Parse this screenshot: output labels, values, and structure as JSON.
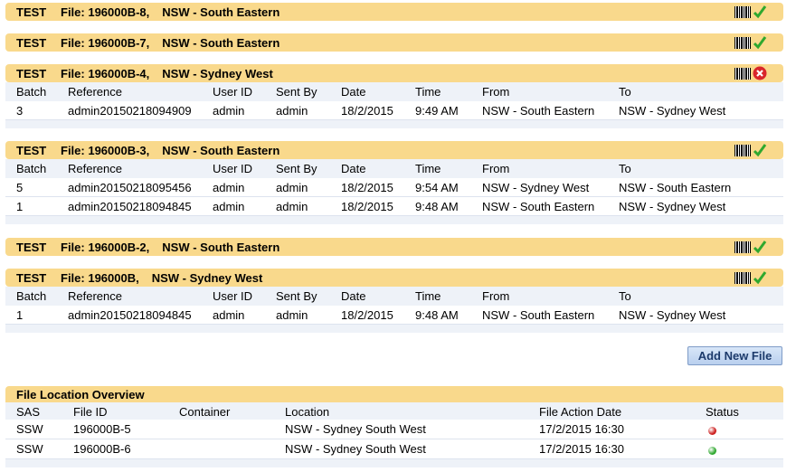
{
  "files": [
    {
      "test": "TEST",
      "file": "File: 196000B-8,",
      "location": "NSW - South Eastern",
      "status": "ok",
      "table": null
    },
    {
      "test": "TEST",
      "file": "File: 196000B-7,",
      "location": "NSW - South Eastern",
      "status": "ok",
      "table": null
    },
    {
      "test": "TEST",
      "file": "File: 196000B-4,",
      "location": "NSW - Sydney West",
      "status": "error",
      "table": {
        "headers": [
          "Batch",
          "Reference",
          "User ID",
          "Sent By",
          "Date",
          "Time",
          "From",
          "To"
        ],
        "rows": [
          [
            "3",
            "admin20150218094909",
            "admin",
            "admin",
            "18/2/2015",
            "9:49 AM",
            "NSW - South Eastern",
            "NSW - Sydney West"
          ]
        ]
      }
    },
    {
      "test": "TEST",
      "file": "File: 196000B-3,",
      "location": "NSW - South Eastern",
      "status": "ok",
      "table": {
        "headers": [
          "Batch",
          "Reference",
          "User ID",
          "Sent By",
          "Date",
          "Time",
          "From",
          "To"
        ],
        "rows": [
          [
            "5",
            "admin20150218095456",
            "admin",
            "admin",
            "18/2/2015",
            "9:54 AM",
            "NSW - Sydney West",
            "NSW - South Eastern"
          ],
          [
            "1",
            "admin20150218094845",
            "admin",
            "admin",
            "18/2/2015",
            "9:48 AM",
            "NSW - South Eastern",
            "NSW - Sydney West"
          ]
        ]
      }
    },
    {
      "test": "TEST",
      "file": "File: 196000B-2,",
      "location": "NSW - South Eastern",
      "status": "ok",
      "table": null
    },
    {
      "test": "TEST",
      "file": "File: 196000B,",
      "location": "NSW - Sydney West",
      "status": "ok",
      "table": {
        "headers": [
          "Batch",
          "Reference",
          "User ID",
          "Sent By",
          "Date",
          "Time",
          "From",
          "To"
        ],
        "rows": [
          [
            "1",
            "admin20150218094845",
            "admin",
            "admin",
            "18/2/2015",
            "9:48 AM",
            "NSW - South Eastern",
            "NSW - Sydney West"
          ]
        ]
      }
    }
  ],
  "add_button_label": "Add New File",
  "overview": {
    "title": "File Location Overview",
    "headers": [
      "SAS",
      "File ID",
      "Container",
      "Location",
      "File Action Date",
      "Status"
    ],
    "rows": [
      {
        "sas": "SSW",
        "file_id": "196000B-5",
        "container": "",
        "location": "NSW - Sydney South West",
        "date": "17/2/2015 16:30",
        "status": "red"
      },
      {
        "sas": "SSW",
        "file_id": "196000B-6",
        "container": "",
        "location": "NSW - Sydney South West",
        "date": "17/2/2015 16:30",
        "status": "green"
      }
    ]
  },
  "colors": {
    "header": "#f9d98c",
    "tablehead": "#eef2f8",
    "ok": "#2fa82f",
    "error": "#d9262a",
    "status_red": "#cc1f1f",
    "status_green": "#2fa82f"
  }
}
